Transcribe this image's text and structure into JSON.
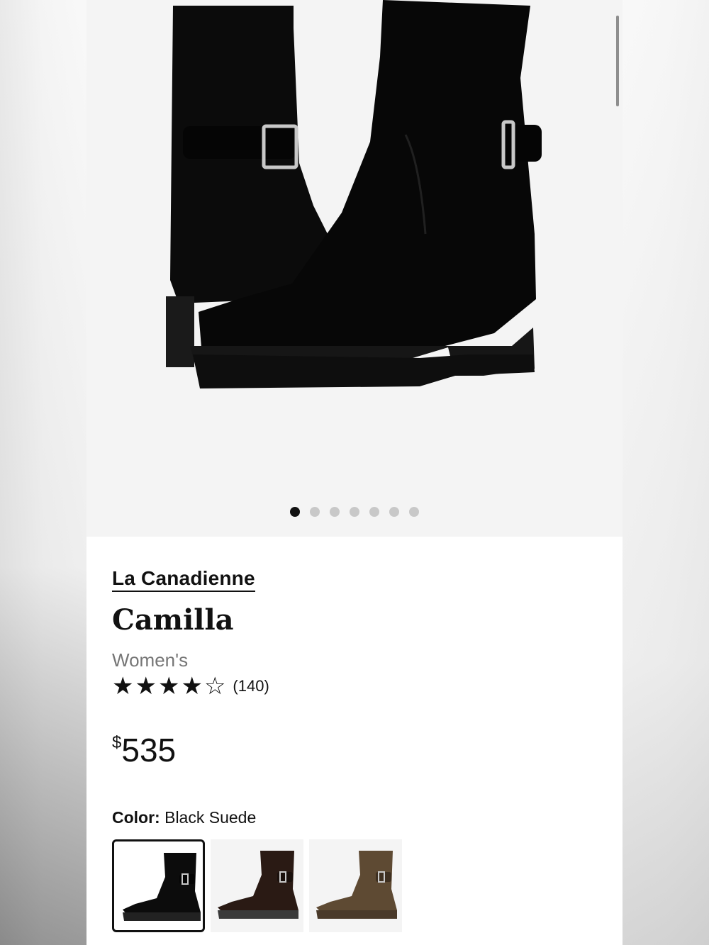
{
  "product": {
    "brand": "La Canadienne",
    "name": "Camilla",
    "gender": "Women's",
    "rating": 4,
    "rating_max": 5,
    "review_count": "(140)",
    "price_currency": "$",
    "price_amount": "535"
  },
  "gallery": {
    "image_count": 7,
    "active_index": 0
  },
  "color": {
    "label": "Color:",
    "selected": "Black Suede",
    "swatches": [
      {
        "color": "#0c0c0c",
        "accent": "#050505"
      },
      {
        "color": "#2a1a14",
        "accent": "#1a100c"
      },
      {
        "color": "#5e4a33",
        "accent": "#3e2f20"
      }
    ]
  },
  "icons": {
    "star_full": "★",
    "star_empty": "☆"
  }
}
